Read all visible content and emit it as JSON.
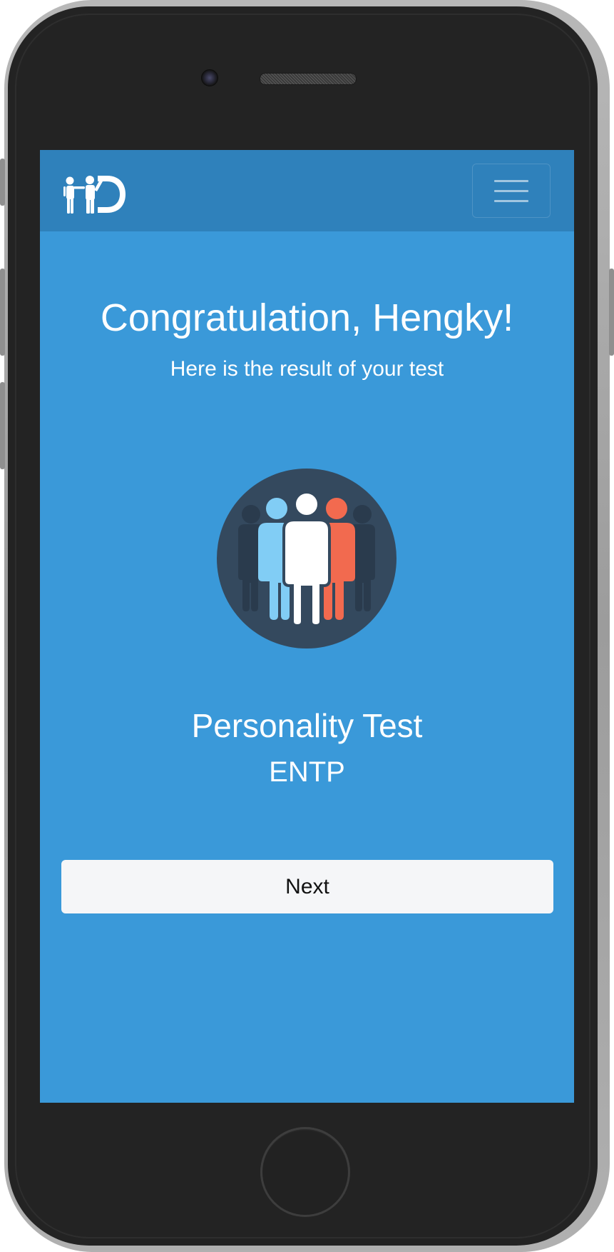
{
  "colors": {
    "screen_background": "#3a99d9",
    "navbar_background": "#2f81bb",
    "button_background": "#f5f6f8",
    "icon_circle": "#34495e",
    "figure_blue": "#81cdf5",
    "figure_white": "#ffffff",
    "figure_red": "#f26a4f"
  },
  "navbar": {
    "logo_icon": "family-logo-icon",
    "menu_icon": "hamburger-menu-icon"
  },
  "result": {
    "headline": "Congratulation, Hengky!",
    "subline": "Here is the result of your test",
    "icon": "people-group-icon",
    "test_name": "Personality Test",
    "test_result": "ENTP"
  },
  "actions": {
    "next_label": "Next"
  }
}
